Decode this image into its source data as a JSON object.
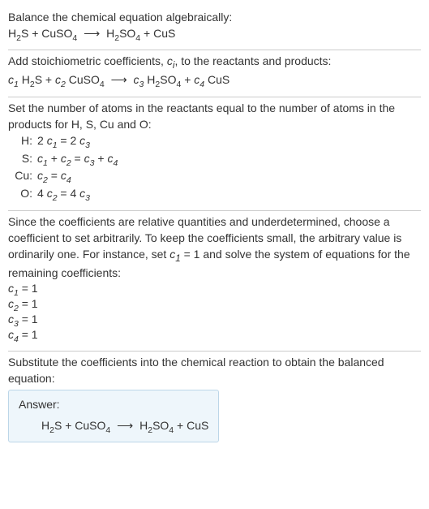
{
  "s1": {
    "intro": "Balance the chemical equation algebraically:",
    "eq_a": "H",
    "eq_b": "2",
    "eq_c": "S + CuSO",
    "eq_d": "4",
    "arrow": "⟶",
    "eq_e": "H",
    "eq_f": "2",
    "eq_g": "SO",
    "eq_h": "4",
    "eq_i": " + CuS"
  },
  "s2": {
    "line_a": "Add stoichiometric coefficients, ",
    "ci_c": "c",
    "ci_i": "i",
    "line_b": ", to the reactants and products:",
    "c1c": "c",
    "c1i": "1",
    "hs_a": " H",
    "hs_b": "2",
    "hs_c": "S + ",
    "c2c": "c",
    "c2i": "2",
    "cu_a": " CuSO",
    "cu_b": "4",
    "arrow": "⟶",
    "c3c": "c",
    "c3i": "3",
    "p_a": " H",
    "p_b": "2",
    "p_c": "SO",
    "p_d": "4",
    "plus": " + ",
    "c4c": "c",
    "c4i": "4",
    "cus": " CuS"
  },
  "s3": {
    "intro": "Set the number of atoms in the reactants equal to the number of atoms in the products for H, S, Cu and O:",
    "rows": {
      "h_lbl": "H:",
      "h_eq_a": "2 ",
      "h_c1c": "c",
      "h_c1i": "1",
      "h_mid": " = 2 ",
      "h_c3c": "c",
      "h_c3i": "3",
      "s_lbl": "S:",
      "s_c1c": "c",
      "s_c1i": "1",
      "s_p1": " + ",
      "s_c2c": "c",
      "s_c2i": "2",
      "s_eq": " = ",
      "s_c3c": "c",
      "s_c3i": "3",
      "s_p2": " + ",
      "s_c4c": "c",
      "s_c4i": "4",
      "cu_lbl": "Cu:",
      "cu_c2c": "c",
      "cu_c2i": "2",
      "cu_eq": " = ",
      "cu_c4c": "c",
      "cu_c4i": "4",
      "o_lbl": "O:",
      "o_a": "4 ",
      "o_c2c": "c",
      "o_c2i": "2",
      "o_mid": " = 4 ",
      "o_c3c": "c",
      "o_c3i": "3"
    }
  },
  "s4": {
    "para_a": "Since the coefficients are relative quantities and underdetermined, choose a coefficient to set arbitrarily. To keep the coefficients small, the arbitrary value is ordinarily one. For instance, set ",
    "c1c": "c",
    "c1i": "1",
    "para_b": " = 1 and solve the system of equations for the remaining coefficients:",
    "r1_c": "c",
    "r1_i": "1",
    "r1_v": " = 1",
    "r2_c": "c",
    "r2_i": "2",
    "r2_v": " = 1",
    "r3_c": "c",
    "r3_i": "3",
    "r3_v": " = 1",
    "r4_c": "c",
    "r4_i": "4",
    "r4_v": " = 1"
  },
  "s5": {
    "intro": "Substitute the coefficients into the chemical reaction to obtain the balanced equation:",
    "answer_label": "Answer:",
    "eq_a": "H",
    "eq_b": "2",
    "eq_c": "S + CuSO",
    "eq_d": "4",
    "arrow": "⟶",
    "eq_e": "H",
    "eq_f": "2",
    "eq_g": "SO",
    "eq_h": "4",
    "eq_i": " + CuS"
  }
}
